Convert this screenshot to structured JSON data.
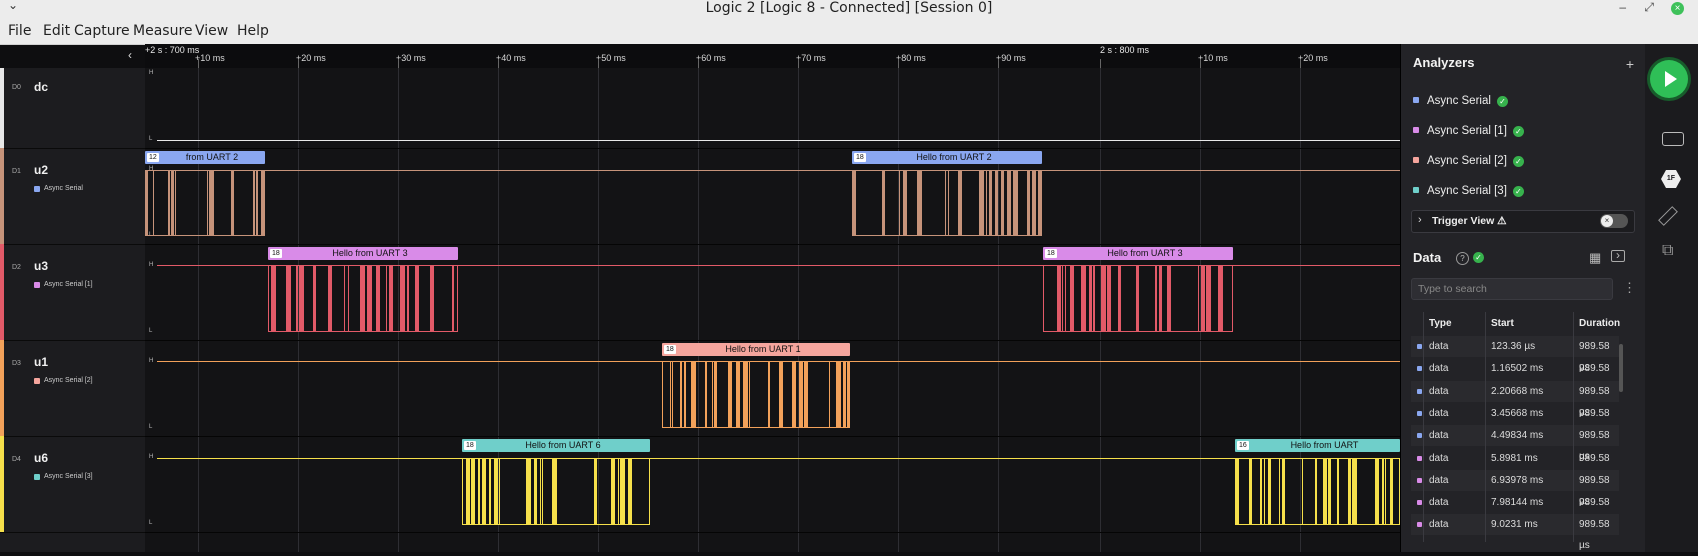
{
  "window": {
    "title": "Logic 2 [Logic 8 - Connected] [Session 0]",
    "chevron": "⌄",
    "minimize": "–",
    "maximize": "⤢",
    "close": "×"
  },
  "menu": [
    "File",
    "Edit",
    "Capture",
    "Measure",
    "View",
    "Help"
  ],
  "timeline": {
    "collapse_icon": "‹",
    "origin_labels": [
      "+2 s : 700 ms",
      "2 s : 800 ms"
    ],
    "ticks": [
      "+10 ms",
      "+20 ms",
      "+30 ms",
      "+40 ms",
      "+50 ms",
      "+60 ms",
      "+70 ms",
      "+80 ms",
      "+90 ms",
      "+10 ms",
      "+20 ms"
    ]
  },
  "channels": [
    {
      "d": "D0",
      "name": "dc",
      "analyzer": "",
      "color": "#e8e8e8"
    },
    {
      "d": "D1",
      "name": "u2",
      "analyzer": "Async Serial",
      "color": "#c6937a"
    },
    {
      "d": "D2",
      "name": "u3",
      "analyzer": "Async Serial [1]",
      "color": "#e25a68"
    },
    {
      "d": "D3",
      "name": "u1",
      "analyzer": "Async Serial [2]",
      "color": "#f2a15a"
    },
    {
      "d": "D4",
      "name": "u6",
      "analyzer": "Async Serial [3]",
      "color": "#f6e04b"
    }
  ],
  "level_labels": {
    "high": "H",
    "low": "L"
  },
  "frames": [
    {
      "ch": 1,
      "count": "12",
      "text": "from UART 2",
      "color": "#8aa7f0"
    },
    {
      "ch": 1,
      "count": "18",
      "text": "Hello from UART 2",
      "color": "#8aa7f0"
    },
    {
      "ch": 2,
      "count": "18",
      "text": "Hello from UART 3",
      "color": "#d98be8"
    },
    {
      "ch": 2,
      "count": "18",
      "text": "Hello from UART 3",
      "color": "#d98be8"
    },
    {
      "ch": 3,
      "count": "18",
      "text": "Hello from UART 1",
      "color": "#f5a59d"
    },
    {
      "ch": 4,
      "count": "18",
      "text": "Hello from UART 6",
      "color": "#6fcfca"
    },
    {
      "ch": 4,
      "count": "16",
      "text": "Hello from UART",
      "color": "#6fcfca"
    }
  ],
  "analyzers_panel": {
    "title": "Analyzers",
    "add": "+",
    "items": [
      {
        "name": "Async Serial",
        "color": "#8aa7f0"
      },
      {
        "name": "Async Serial [1]",
        "color": "#d98be8"
      },
      {
        "name": "Async Serial [2]",
        "color": "#f5a59d"
      },
      {
        "name": "Async Serial [3]",
        "color": "#6fcfca"
      }
    ],
    "trigger_view": "Trigger View ⚠"
  },
  "data_panel": {
    "title": "Data",
    "help": "?",
    "search_placeholder": "Type to search",
    "columns": [
      "Type",
      "Start",
      "Duration"
    ],
    "rows": [
      {
        "type": "data",
        "start": "123.36 µs",
        "duration": "989.58 µs",
        "color": "#8aa7f0"
      },
      {
        "type": "data",
        "start": "1.16502 ms",
        "duration": "989.58 µs",
        "color": "#8aa7f0"
      },
      {
        "type": "data",
        "start": "2.20668 ms",
        "duration": "989.58 µs",
        "color": "#8aa7f0"
      },
      {
        "type": "data",
        "start": "3.45668 ms",
        "duration": "989.58 µs",
        "color": "#8aa7f0"
      },
      {
        "type": "data",
        "start": "4.49834 ms",
        "duration": "989.58 µs",
        "color": "#8aa7f0"
      },
      {
        "type": "data",
        "start": "5.8981 ms",
        "duration": "989.58 µs",
        "color": "#d98be8"
      },
      {
        "type": "data",
        "start": "6.93978 ms",
        "duration": "989.58 µs",
        "color": "#d98be8"
      },
      {
        "type": "data",
        "start": "7.98144 ms",
        "duration": "989.58 µs",
        "color": "#d98be8"
      },
      {
        "type": "data",
        "start": "9.0231 ms",
        "duration": "989.58 µs",
        "color": "#d98be8"
      }
    ]
  },
  "sidebar": {
    "icons": [
      "play-icon",
      "device-icon",
      "analyzer-1f-icon",
      "ruler-icon",
      "extensions-icon"
    ],
    "badge_1f": "1F"
  }
}
